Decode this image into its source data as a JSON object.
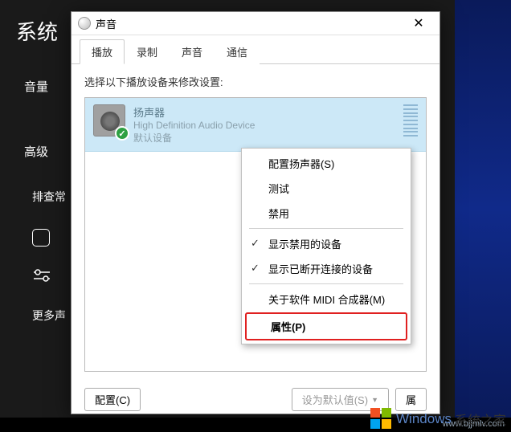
{
  "bg": {
    "title": "系统",
    "items": [
      "音量",
      "高级"
    ],
    "sub": [
      "排查常",
      "更多声"
    ]
  },
  "dialog": {
    "title": "声音",
    "tabs": [
      "播放",
      "录制",
      "声音",
      "通信"
    ],
    "active_tab": 0,
    "instruction": "选择以下播放设备来修改设置:",
    "device": {
      "name": "扬声器",
      "desc": "High Definition Audio Device",
      "status": "默认设备"
    },
    "buttons": {
      "configure": "配置(C)",
      "set_default": "设为默认值(S)",
      "properties": "属"
    }
  },
  "menu": {
    "configure_speaker": "配置扬声器(S)",
    "test": "测试",
    "disable": "禁用",
    "show_disabled": "显示禁用的设备",
    "show_disconnected": "显示已断开连接的设备",
    "about_midi": "关于软件 MIDI 合成器(M)",
    "properties": "属性(P)"
  },
  "watermark": {
    "brand": "Windows",
    "suffix": "系统之家",
    "url": "www.bjjmlv.com"
  }
}
